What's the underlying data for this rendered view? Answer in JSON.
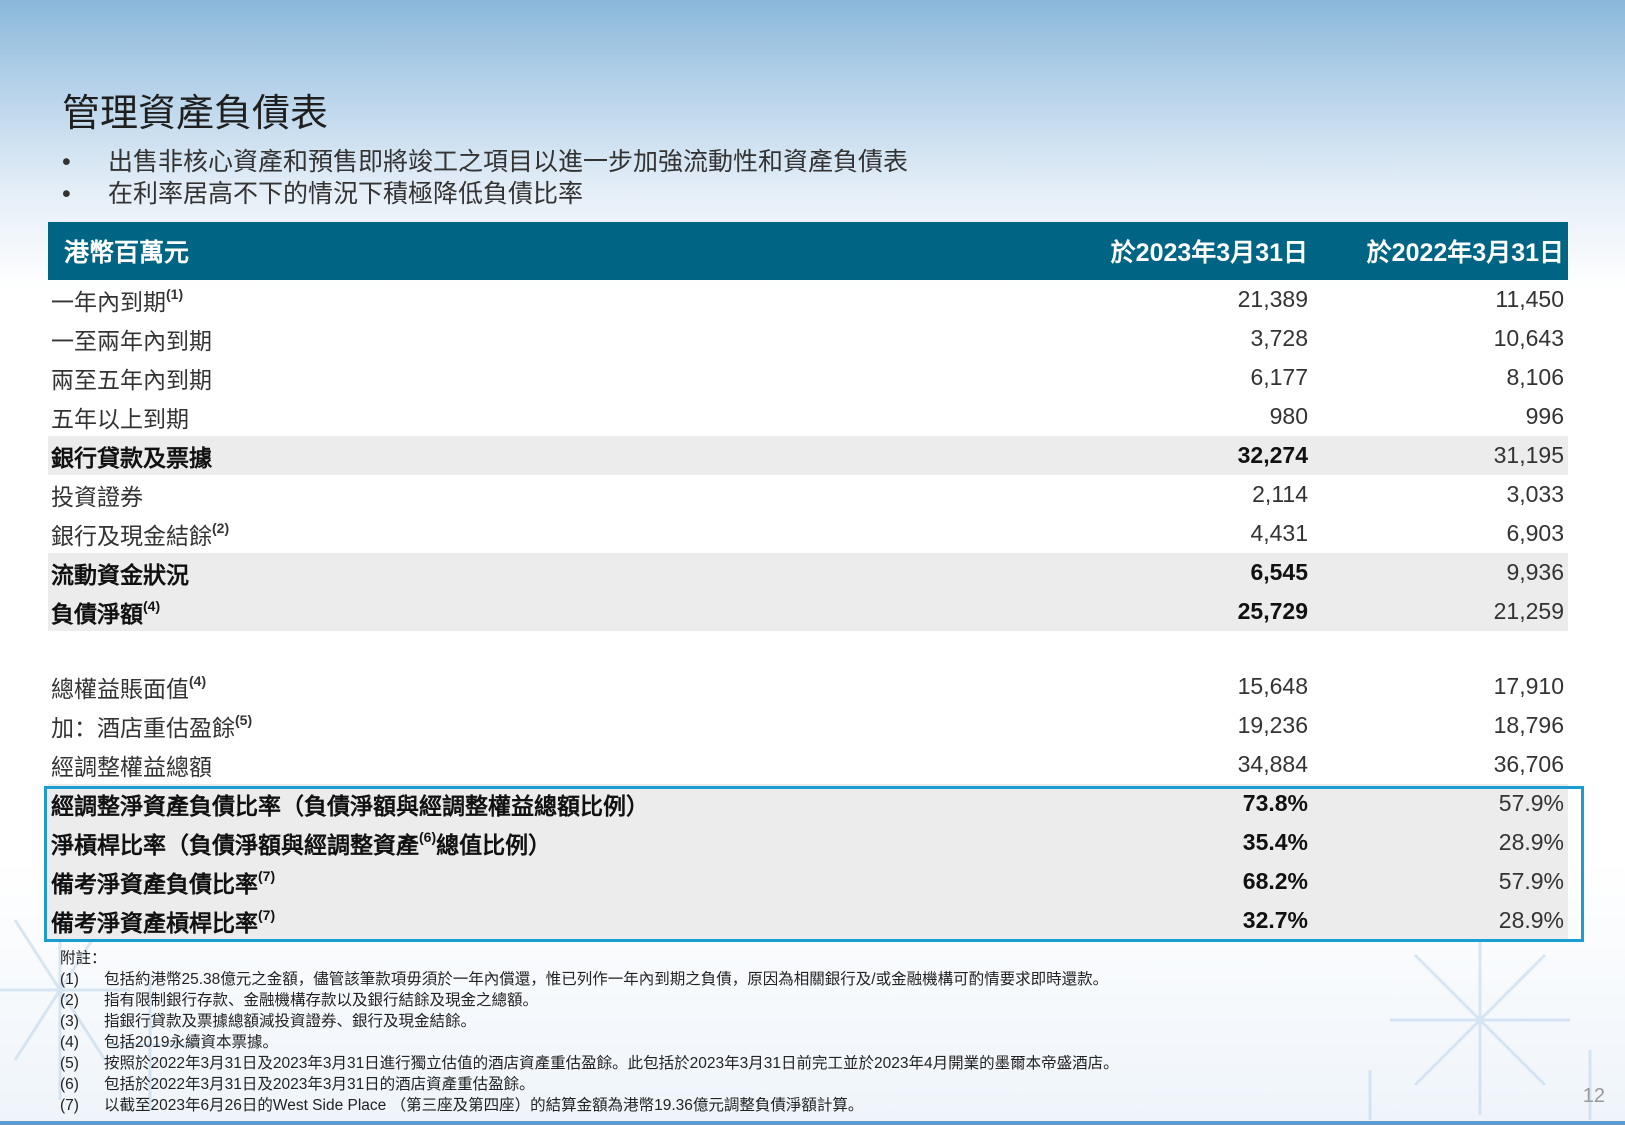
{
  "title": "管理資產負債表",
  "bullets": [
    "出售非核心資產和預售即將竣工之項目以進一步加強流動性和資產負債表",
    "在利率居高不下的情況下積極降低負債比率"
  ],
  "chart_data": {
    "type": "table",
    "columns": [
      "港幣百萬元",
      "於2023年3月31日",
      "於2022年3月31日"
    ],
    "rows": [
      {
        "label": "一年內到期",
        "note": "(1)",
        "v2023": "21,389",
        "v2022": "11,450"
      },
      {
        "label": "一至兩年內到期",
        "note": "",
        "v2023": "3,728",
        "v2022": "10,643"
      },
      {
        "label": "兩至五年內到期",
        "note": "",
        "v2023": "6,177",
        "v2022": "8,106"
      },
      {
        "label": "五年以上到期",
        "note": "",
        "v2023": "980",
        "v2022": "996"
      },
      {
        "label": "銀行貸款及票據",
        "note": "",
        "v2023": "32,274",
        "v2022": "31,195"
      },
      {
        "label": "投資證券",
        "note": "",
        "v2023": "2,114",
        "v2022": "3,033"
      },
      {
        "label": "銀行及現金結餘",
        "note": "(2)",
        "v2023": "4,431",
        "v2022": "6,903"
      },
      {
        "label": "流動資金狀況",
        "note": "",
        "v2023": "6,545",
        "v2022": "9,936"
      },
      {
        "label": "負債淨額",
        "note": "(4)",
        "v2023": "25,729",
        "v2022": "21,259"
      },
      {
        "label": "總權益賬面值",
        "note": "(4)",
        "v2023": "15,648",
        "v2022": "17,910"
      },
      {
        "label": "加：酒店重估盈餘",
        "note": "(5)",
        "v2023": "19,236",
        "v2022": "18,796"
      },
      {
        "label": "經調整權益總額",
        "note": "",
        "v2023": "34,884",
        "v2022": "36,706"
      },
      {
        "label": "經調整淨資產負債比率（負債淨額與經調整權益總額比例）",
        "note": "",
        "v2023": "73.8%",
        "v2022": "57.9%"
      },
      {
        "label": "淨槓桿比率（負債淨額與經調整資產",
        "note": "(6)",
        "label_suffix": "總值比例）",
        "v2023": "35.4%",
        "v2022": "28.9%"
      },
      {
        "label": "備考淨資產負債比率",
        "note": "(7)",
        "v2023": "68.2%",
        "v2022": "57.9%"
      },
      {
        "label": "備考淨資產槓桿比率",
        "note": "(7)",
        "v2023": "32.7%",
        "v2022": "28.9%"
      }
    ]
  },
  "notes_title": "附註：",
  "notes": [
    {
      "n": "(1)",
      "text": "包括約港幣25.38億元之金額，儘管該筆款項毋須於一年內償還，惟已列作一年內到期之負債，原因為相關銀行及/或金融機構可酌情要求即時還款。"
    },
    {
      "n": "(2)",
      "text": "指有限制銀行存款、金融機構存款以及銀行結餘及現金之總額。"
    },
    {
      "n": "(3)",
      "text": "指銀行貸款及票據總額減投資證券、銀行及現金結餘。"
    },
    {
      "n": "(4)",
      "text": "包括2019永續資本票據。"
    },
    {
      "n": "(5)",
      "text": "按照於2022年3月31日及2023年3月31日進行獨立估值的酒店資產重估盈餘。此包括於2023年3月31日前完工並於2023年4月開業的墨爾本帝盛酒店。"
    },
    {
      "n": "(6)",
      "text": "包括於2022年3月31日及2023年3月31日的酒店資產重估盈餘。"
    },
    {
      "n": "(7)",
      "text": "以截至2023年6月26日的West Side Place （第三座及第四座）的結算金額為港幣19.36億元調整負債淨額計算。"
    }
  ],
  "page_number": "12",
  "colors": {
    "header_bg": "#006585",
    "ratio_border": "#1a9ed2",
    "shade": "#ececec"
  }
}
